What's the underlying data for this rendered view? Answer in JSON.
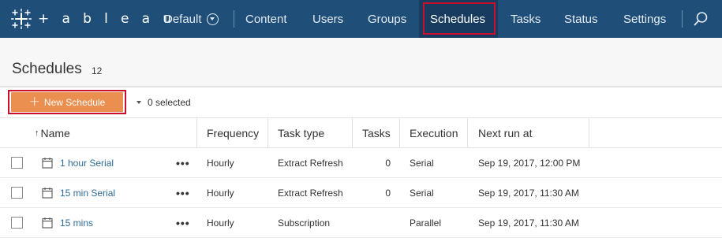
{
  "app": {
    "logo_text": "+ a b l e a u"
  },
  "nav": {
    "site_label": "Default",
    "items": [
      {
        "label": "Content"
      },
      {
        "label": "Users"
      },
      {
        "label": "Groups"
      },
      {
        "label": "Schedules",
        "active": true
      },
      {
        "label": "Tasks"
      },
      {
        "label": "Status"
      },
      {
        "label": "Settings"
      }
    ]
  },
  "page": {
    "title": "Schedules",
    "count": "12"
  },
  "toolbar": {
    "new_button_label": "New Schedule",
    "selected_label": "0 selected"
  },
  "table": {
    "columns": [
      "Name",
      "Frequency",
      "Task type",
      "Tasks",
      "Execution",
      "Next run at"
    ],
    "sort_indicator": "↑",
    "rows": [
      {
        "name": "1 hour Serial",
        "frequency": "Hourly",
        "task_type": "Extract Refresh",
        "tasks": "0",
        "execution": "Serial",
        "next_run": "Sep 19, 2017, 12:00 PM"
      },
      {
        "name": "15 min Serial",
        "frequency": "Hourly",
        "task_type": "Extract Refresh",
        "tasks": "0",
        "execution": "Serial",
        "next_run": "Sep 19, 2017, 11:30 AM"
      },
      {
        "name": "15 mins",
        "frequency": "Hourly",
        "task_type": "Subscription",
        "tasks": "",
        "execution": "Parallel",
        "next_run": "Sep 19, 2017, 11:30 AM"
      }
    ],
    "row_menu": "•••"
  },
  "colors": {
    "nav_bg": "#1f4e79",
    "accent_orange": "#eb8f50",
    "highlight_red": "#c8102e",
    "link": "#2e6b97"
  }
}
